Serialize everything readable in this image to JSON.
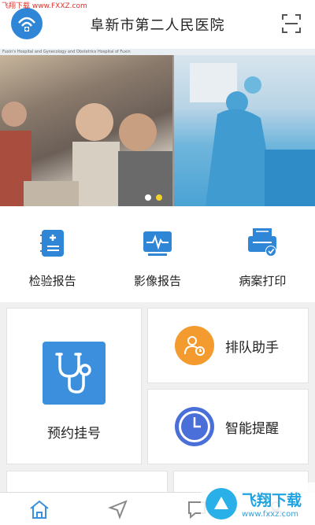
{
  "watermark_top": "飞翔下载 www.FXXZ.com",
  "header": {
    "title": "阜新市第二人民医院"
  },
  "banner": {
    "caption": "Fuxin's Hospital and Gynecology and Obstetrics Hospital of Fuxin",
    "slides": 2,
    "active_slide": 2
  },
  "quick_actions": [
    {
      "label": "检验报告",
      "icon": "report-clipboard-icon"
    },
    {
      "label": "影像报告",
      "icon": "monitor-heartbeat-icon"
    },
    {
      "label": "病案打印",
      "icon": "printer-check-icon"
    }
  ],
  "tiles": {
    "appointment": {
      "label": "预约挂号",
      "icon": "stethoscope-icon"
    },
    "queue": {
      "label": "排队助手",
      "icon": "user-clock-icon"
    },
    "reminder": {
      "label": "智能提醒",
      "icon": "clock-icon"
    }
  },
  "tabbar": [
    "home-icon",
    "navigation-icon",
    "chat-icon",
    "profile-icon"
  ],
  "watermark_br": {
    "main": "飞翔下载",
    "sub": "www.fxxz.com"
  },
  "colors": {
    "accent": "#2f86d6",
    "queue": "#f39b2e",
    "reminder": "#4a6fd9",
    "dot_active": "#f2d22a"
  }
}
